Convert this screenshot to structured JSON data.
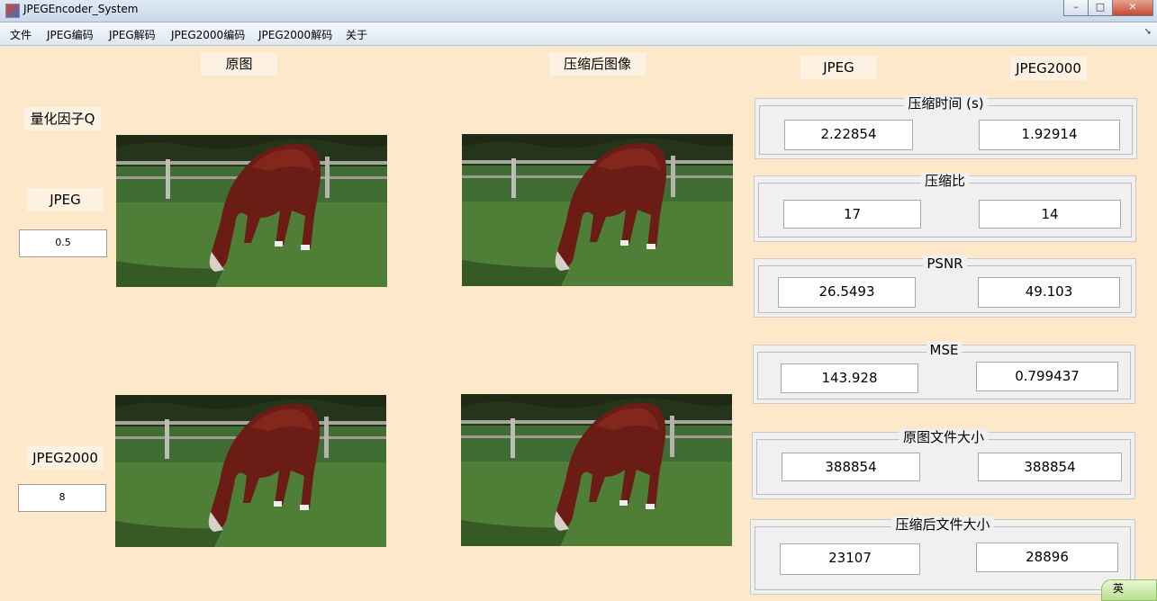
{
  "window": {
    "title": "JPEGEncoder_System"
  },
  "menu": [
    "文件",
    "JPEG编码",
    "JPEG解码",
    "JPEG2000编码",
    "JPEG2000解码",
    "关于"
  ],
  "labels": {
    "original": "原图",
    "compressed": "压缩后图像",
    "col_jpeg": "JPEG",
    "col_jpeg2000": "JPEG2000",
    "quant_factor": "量化因子Q",
    "row_jpeg": "JPEG",
    "row_jpeg2000": "JPEG2000"
  },
  "inputs": {
    "jpeg_q": "0.5",
    "jpeg2000_q": "8"
  },
  "panels": {
    "compress_time": {
      "title": "压缩时间 (s)",
      "jpeg": "2.22854",
      "jpeg2000": "1.92914"
    },
    "compress_ratio": {
      "title": "压缩比",
      "jpeg": "17",
      "jpeg2000": "14"
    },
    "psnr": {
      "title": "PSNR",
      "jpeg": "26.5493",
      "jpeg2000": "49.103"
    },
    "mse": {
      "title": "MSE",
      "jpeg": "143.928",
      "jpeg2000": "0.799437"
    },
    "orig_size": {
      "title": "原图文件大小",
      "jpeg": "388854",
      "jpeg2000": "388854"
    },
    "comp_size": {
      "title": "压缩后文件大小",
      "jpeg": "23107",
      "jpeg2000": "28896"
    }
  },
  "ime": "英"
}
